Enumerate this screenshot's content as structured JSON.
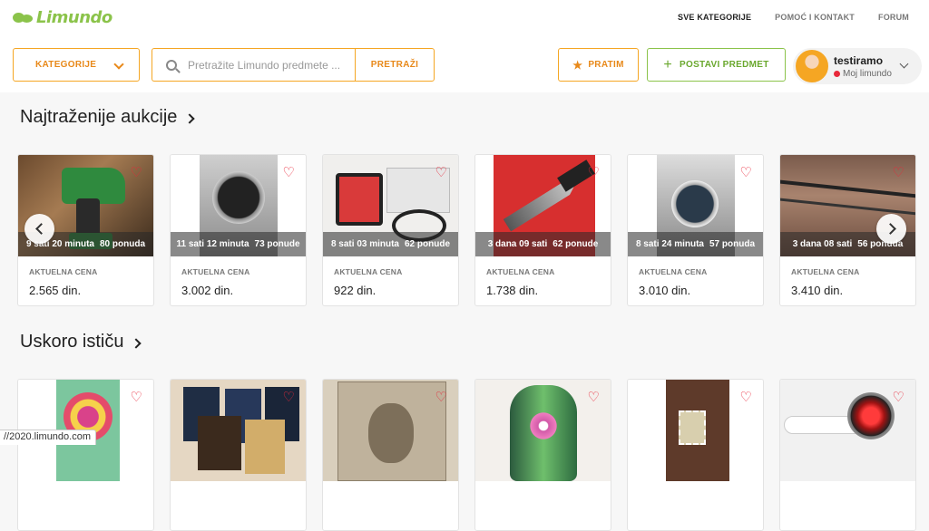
{
  "header": {
    "logo_text": "Limundo",
    "nav": [
      {
        "label": "SVE KATEGORIJE",
        "active": true
      },
      {
        "label": "POMOĆ I KONTAKT",
        "active": false
      },
      {
        "label": "FORUM",
        "active": false
      }
    ],
    "categories_label": "KATEGORIJE",
    "search": {
      "placeholder": "Pretražite Limundo predmete ...",
      "value": "",
      "button_label": "PRETRAŽI"
    },
    "follow_label": "PRATIM",
    "post_label": "POSTAVI PREDMET",
    "user": {
      "name": "testiramo",
      "status": "Moj limundo"
    }
  },
  "sections": [
    {
      "title": "Najtraženije aukcije",
      "items": [
        {
          "time": "9 sati 20 minuta",
          "bids": "80 ponuda",
          "price_label": "AKTUELNA CENA",
          "price": "2.565 din.",
          "icon": "drill"
        },
        {
          "time": "11 sati 12 minuta",
          "bids": "73 ponude",
          "price_label": "AKTUELNA CENA",
          "price": "3.002 din.",
          "icon": "watch"
        },
        {
          "time": "8 sati 03 minuta",
          "bids": "62 ponude",
          "price_label": "AKTUELNA CENA",
          "price": "922 din.",
          "icon": "smart-band"
        },
        {
          "time": "3 dana 09 sati",
          "bids": "62 ponude",
          "price_label": "AKTUELNA CENA",
          "price": "1.738 din.",
          "icon": "knife"
        },
        {
          "time": "8 sati 24 minuta",
          "bids": "57 ponuda",
          "price_label": "AKTUELNA CENA",
          "price": "3.010 din.",
          "icon": "watch"
        },
        {
          "time": "3 dana 08 sati",
          "bids": "56 ponuda",
          "price_label": "AKTUELNA CENA",
          "price": "3.410 din.",
          "icon": "fishing-rod"
        }
      ]
    },
    {
      "title": "Uskoro ističu",
      "items": [
        {
          "icon": "tshirt"
        },
        {
          "icon": "books"
        },
        {
          "icon": "book"
        },
        {
          "icon": "vase"
        },
        {
          "icon": "stamp"
        },
        {
          "icon": "lamp"
        }
      ]
    }
  ],
  "status_url": "//2020.limundo.com",
  "colors": {
    "accent_orange": "#f5a623",
    "brand_green": "#8bc34a",
    "heart_red": "#e8283a"
  }
}
